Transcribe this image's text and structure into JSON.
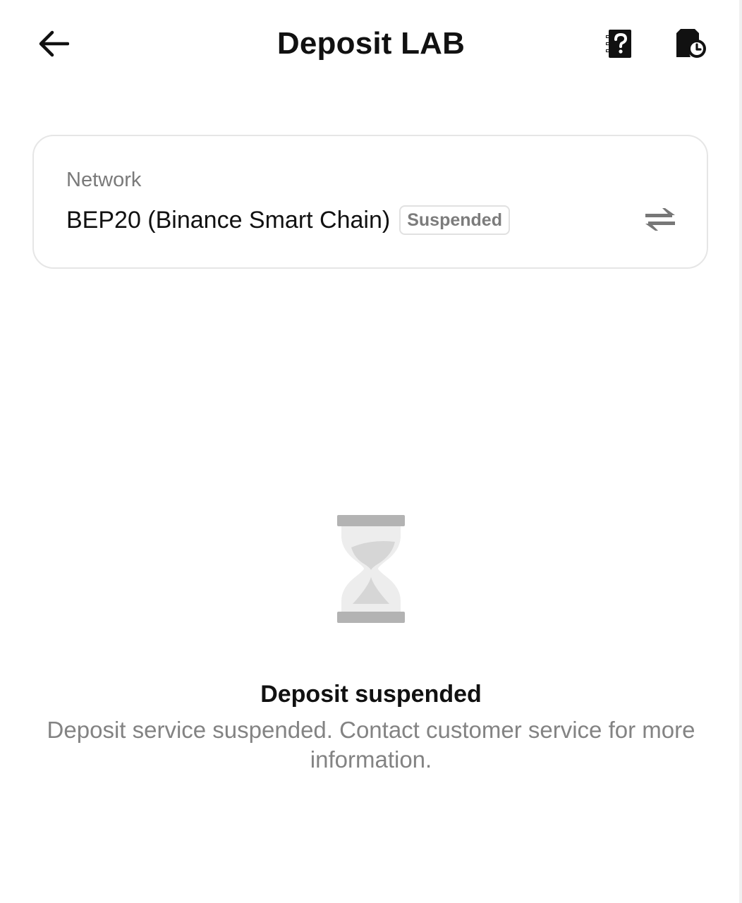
{
  "header": {
    "title": "Deposit LAB",
    "back_icon": "arrow-left-icon",
    "faq_icon": "question-doc-icon",
    "history_icon": "file-clock-icon"
  },
  "network": {
    "label": "Network",
    "value": "BEP20 (Binance Smart Chain)",
    "status": "Suspended",
    "switch_icon": "swap-arrows-icon"
  },
  "empty_state": {
    "icon": "hourglass-icon",
    "title": "Deposit suspended",
    "description": "Deposit service suspended. Contact customer service for more information."
  },
  "colors": {
    "text_primary": "#111111",
    "text_secondary": "#7a7a7a",
    "border": "#e6e6e6",
    "icon_gray": "#b3b3b3"
  }
}
